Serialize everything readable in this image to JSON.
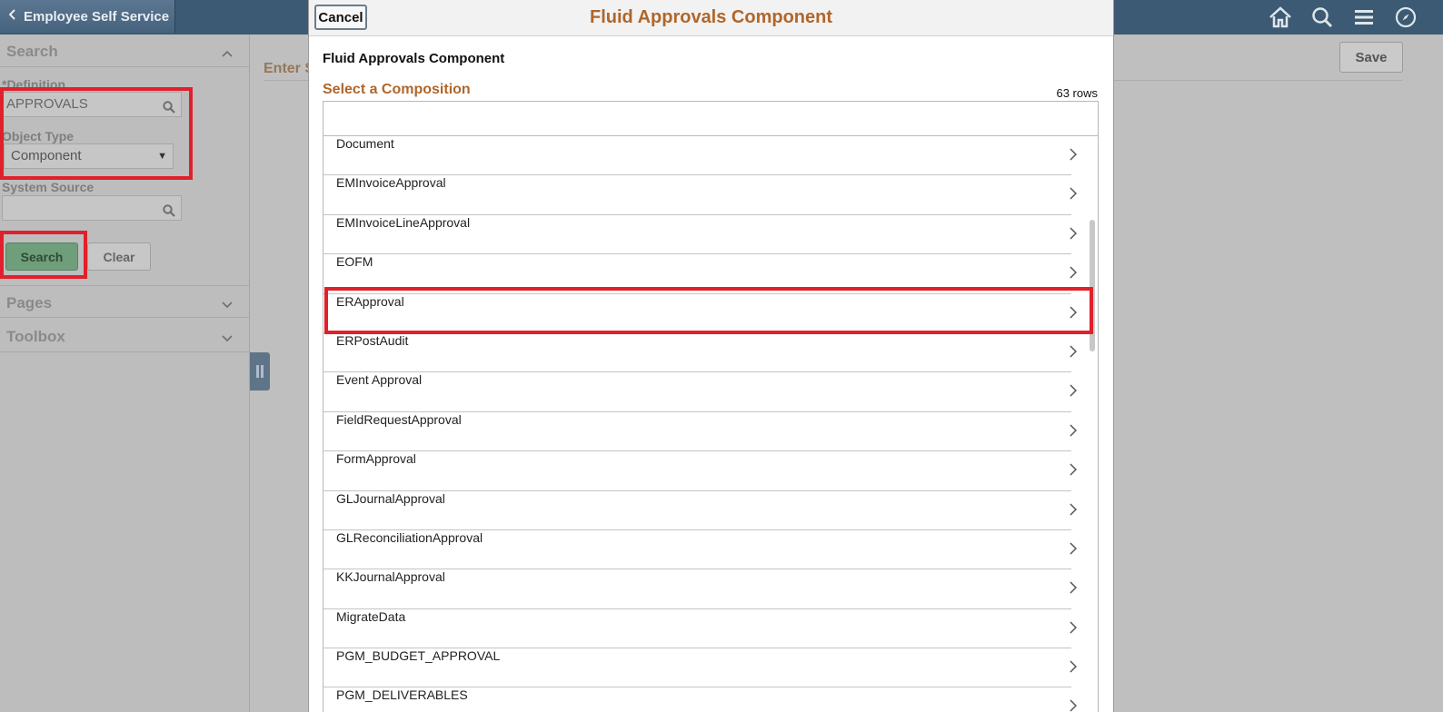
{
  "header": {
    "back_label": "Employee Self Service"
  },
  "left_panel": {
    "search_title": "Search",
    "definition_label": "*Definition",
    "definition_value": "APPROVALS",
    "object_type_label": "Object Type",
    "object_type_value": "Component",
    "system_source_label": "System Source",
    "system_source_value": "",
    "search_button": "Search",
    "clear_button": "Clear",
    "pages_title": "Pages",
    "toolbox_title": "Toolbox"
  },
  "main": {
    "enter_label": "Enter S",
    "save_button": "Save"
  },
  "modal": {
    "cancel_button": "Cancel",
    "title": "Fluid Approvals Component",
    "component_name": "Fluid Approvals Component",
    "select_label": "Select a Composition",
    "row_count": "63 rows",
    "items": [
      "Document",
      "EMInvoiceApproval",
      "EMInvoiceLineApproval",
      "EOFM",
      "ERApproval",
      "ERPostAudit",
      "Event Approval",
      "FieldRequestApproval",
      "FormApproval",
      "GLJournalApproval",
      "GLReconciliationApproval",
      "KKJournalApproval",
      "MigrateData",
      "PGM_BUDGET_APPROVAL",
      "PGM_DELIVERABLES"
    ],
    "highlighted_item": "ERApproval"
  },
  "colors": {
    "accent_orange": "#b0662a",
    "highlight_red": "#e0202a",
    "banner": "#3c5a73"
  },
  "icons": [
    "chevron-left-icon",
    "home-icon",
    "search-icon",
    "menu-icon",
    "compass-icon",
    "chevron-right-icon",
    "chevron-up-icon",
    "chevron-down-icon"
  ]
}
